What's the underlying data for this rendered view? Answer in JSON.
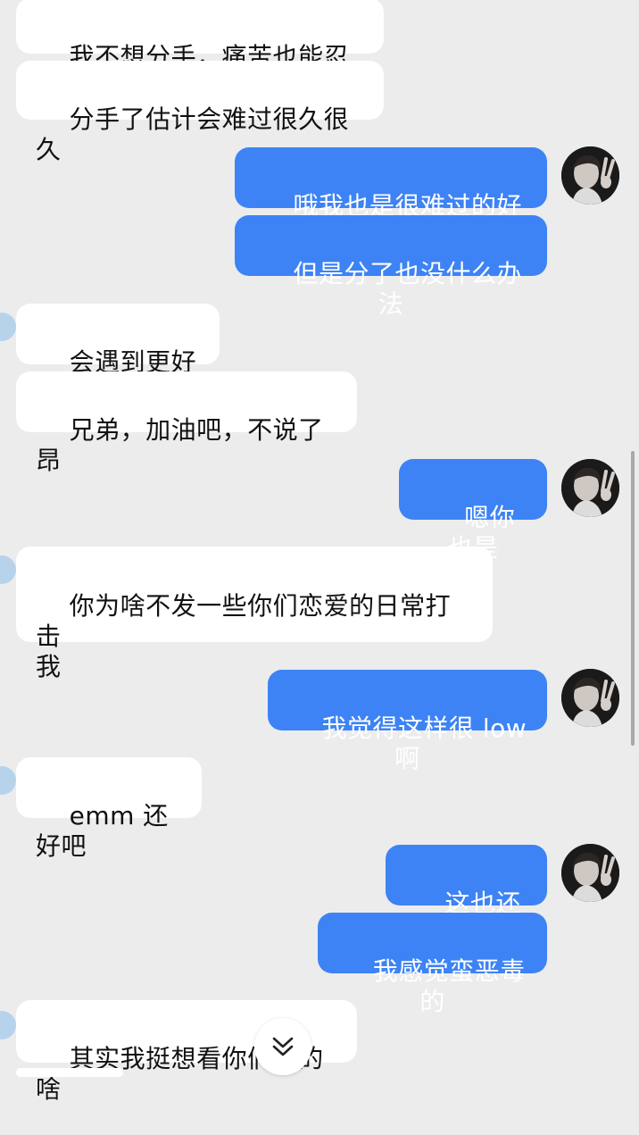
{
  "conversation": {
    "messages": [
      {
        "sender": "peer",
        "text": "我不想分手，痛苦也能忍受"
      },
      {
        "sender": "peer",
        "text": "分手了估计会难过很久很久"
      },
      {
        "sender": "self",
        "text": "哦我也是很难过的好吗"
      },
      {
        "sender": "self",
        "text": "但是分了也没什么办法"
      },
      {
        "sender": "peer",
        "text": "会遇到更好的"
      },
      {
        "sender": "peer",
        "text": "兄弟，加油吧，不说了昂"
      },
      {
        "sender": "self",
        "text": "嗯你也是"
      },
      {
        "sender": "peer",
        "text": "你为啥不发一些你们恋爱的日常打击\n我"
      },
      {
        "sender": "self",
        "text": "我觉得这样很 low啊"
      },
      {
        "sender": "peer",
        "text": "emm 还好吧"
      },
      {
        "sender": "self",
        "text": "这也还好?"
      },
      {
        "sender": "self",
        "text": "我感觉蛮恶毒的"
      },
      {
        "sender": "peer",
        "text": "其实我挺想看你们聊的啥"
      }
    ]
  },
  "controls": {
    "scroll_down_icon": "double-chevron-down-icon"
  },
  "colors": {
    "background": "#ececec",
    "incoming_bubble": "#ffffff",
    "outgoing_bubble": "#3d83f5",
    "peer_avatar": "#b7d3ec"
  }
}
